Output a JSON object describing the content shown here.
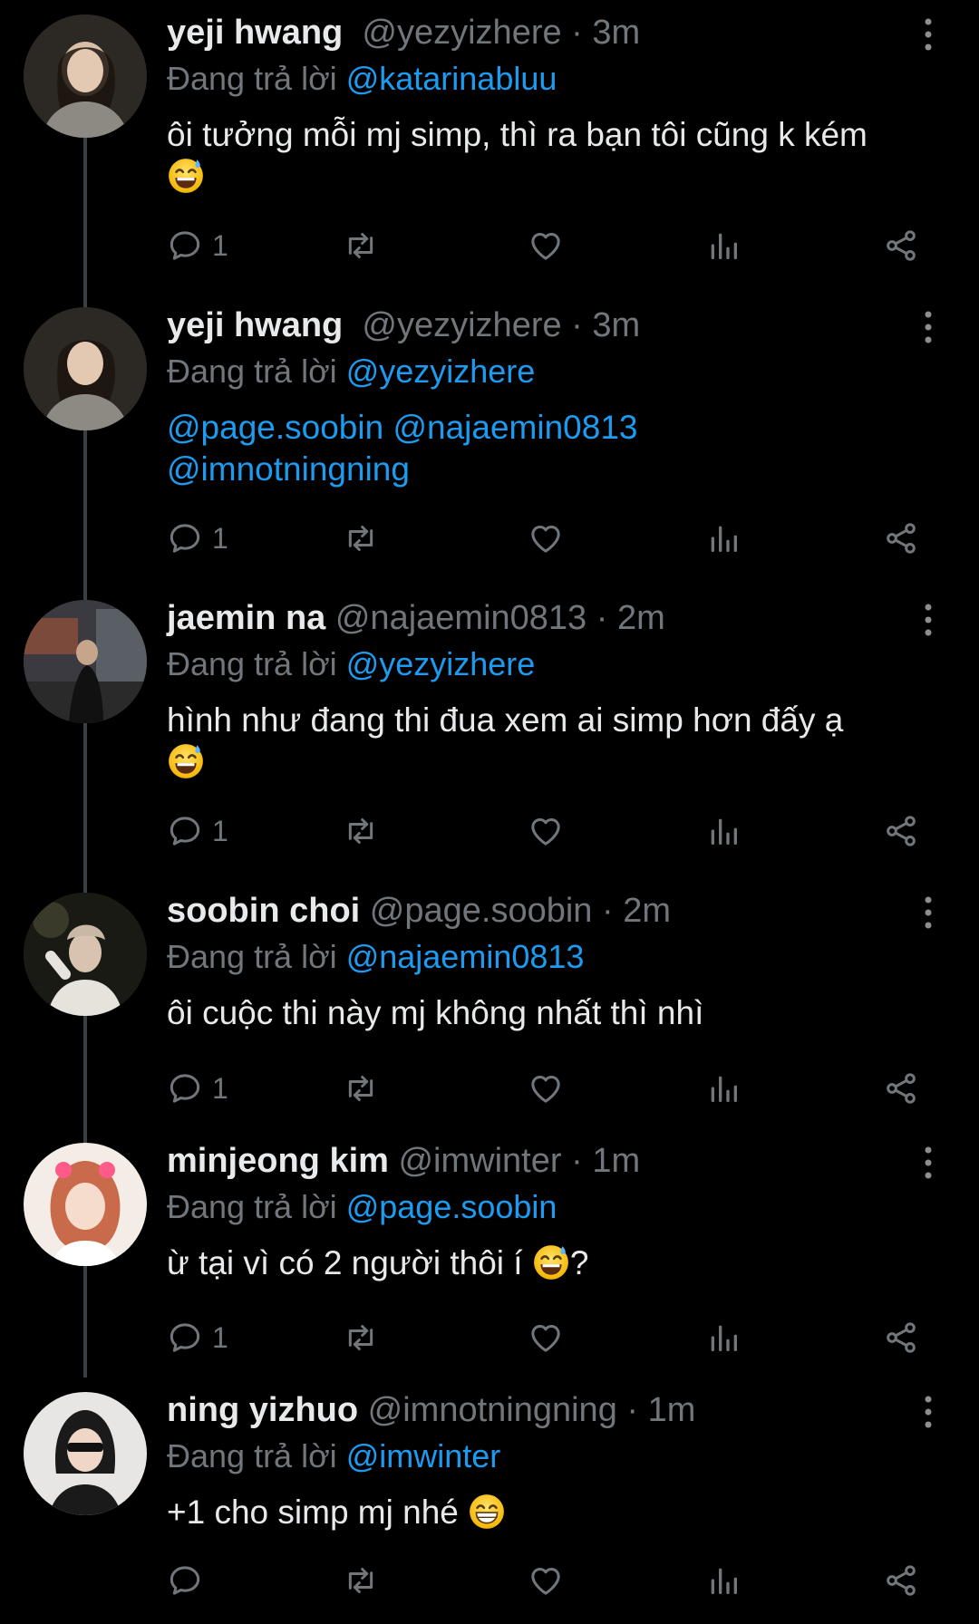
{
  "reply_prefix": "Đang trả lời",
  "tweets": [
    {
      "name": "yeji hwang",
      "handle": "@yezyizhere",
      "time": "3m",
      "reply_to": "@katarinabluu",
      "text": "ôi tưởng mỗi mj simp, thì ra bạn tôi cũng k kém",
      "emoji": "sweat-smile-emoji",
      "reply_count": "1"
    },
    {
      "name": "yeji hwang",
      "handle": "@yezyizhere",
      "time": "3m",
      "reply_to": "@yezyizhere",
      "mentions_line1": "@page.soobin @najaemin0813",
      "mentions_line2": "@imnotningning",
      "reply_count": "1"
    },
    {
      "name": "jaemin na",
      "handle": "@najaemin0813",
      "time": "2m",
      "reply_to": "@yezyizhere",
      "text": "hình như đang thi đua xem ai simp hơn đấy ạ",
      "emoji": "sweat-smile-emoji",
      "reply_count": "1"
    },
    {
      "name": "soobin choi",
      "handle": "@page.soobin",
      "time": "2m",
      "reply_to": "@najaemin0813",
      "text": "ôi cuộc thi này mj không nhất thì nhì",
      "reply_count": "1"
    },
    {
      "name": "minjeong kim",
      "handle": "@imwinter",
      "time": "1m",
      "reply_to": "@page.soobin",
      "text": "ừ tại vì có 2 người thôi í",
      "text_after_emoji": "?",
      "emoji": "sweat-smile-emoji",
      "reply_count": "1"
    },
    {
      "name": "ning yizhuo",
      "handle": "@imnotningning",
      "time": "1m",
      "reply_to": "@imwinter",
      "text": "+1 cho simp mj nhé",
      "emoji": "grinning-emoji",
      "reply_count": ""
    }
  ],
  "colors": {
    "background": "#000000",
    "text": "#e7e9ea",
    "muted": "#71767b",
    "link": "#1d9bf0",
    "thread_line": "#3a3f44"
  }
}
